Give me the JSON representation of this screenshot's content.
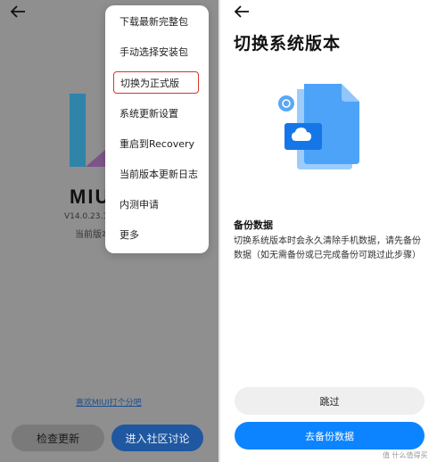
{
  "left": {
    "menu": {
      "items": [
        "下载最新完整包",
        "手动选择安装包",
        "切换为正式版",
        "系统更新设置",
        "重启到Recovery",
        "当前版本更新日志",
        "内测申请",
        "更多"
      ]
    },
    "brand": "MIUI",
    "version": "V14.0.23.1...",
    "channel": "当前版本",
    "like_link": "喜欢MIUI打个分吧",
    "check_update_label": "检查更新",
    "community_label": "进入社区讨论"
  },
  "right": {
    "title": "切换系统版本",
    "section_heading": "备份数据",
    "section_body": "切换系统版本时会永久清除手机数据，请先备份数据（如无需备份或已完成备份可跳过此步骤）",
    "skip_label": "跳过",
    "backup_label": "去备份数据",
    "watermark": "值 什么值得买"
  },
  "colors": {
    "accent_blue": "#0d84ff",
    "highlight_red": "#d9342b",
    "overlay_gray": "#8f8f8f"
  },
  "icons": {
    "back": "back-arrow-icon",
    "illustration": "file-cloud-icon"
  }
}
